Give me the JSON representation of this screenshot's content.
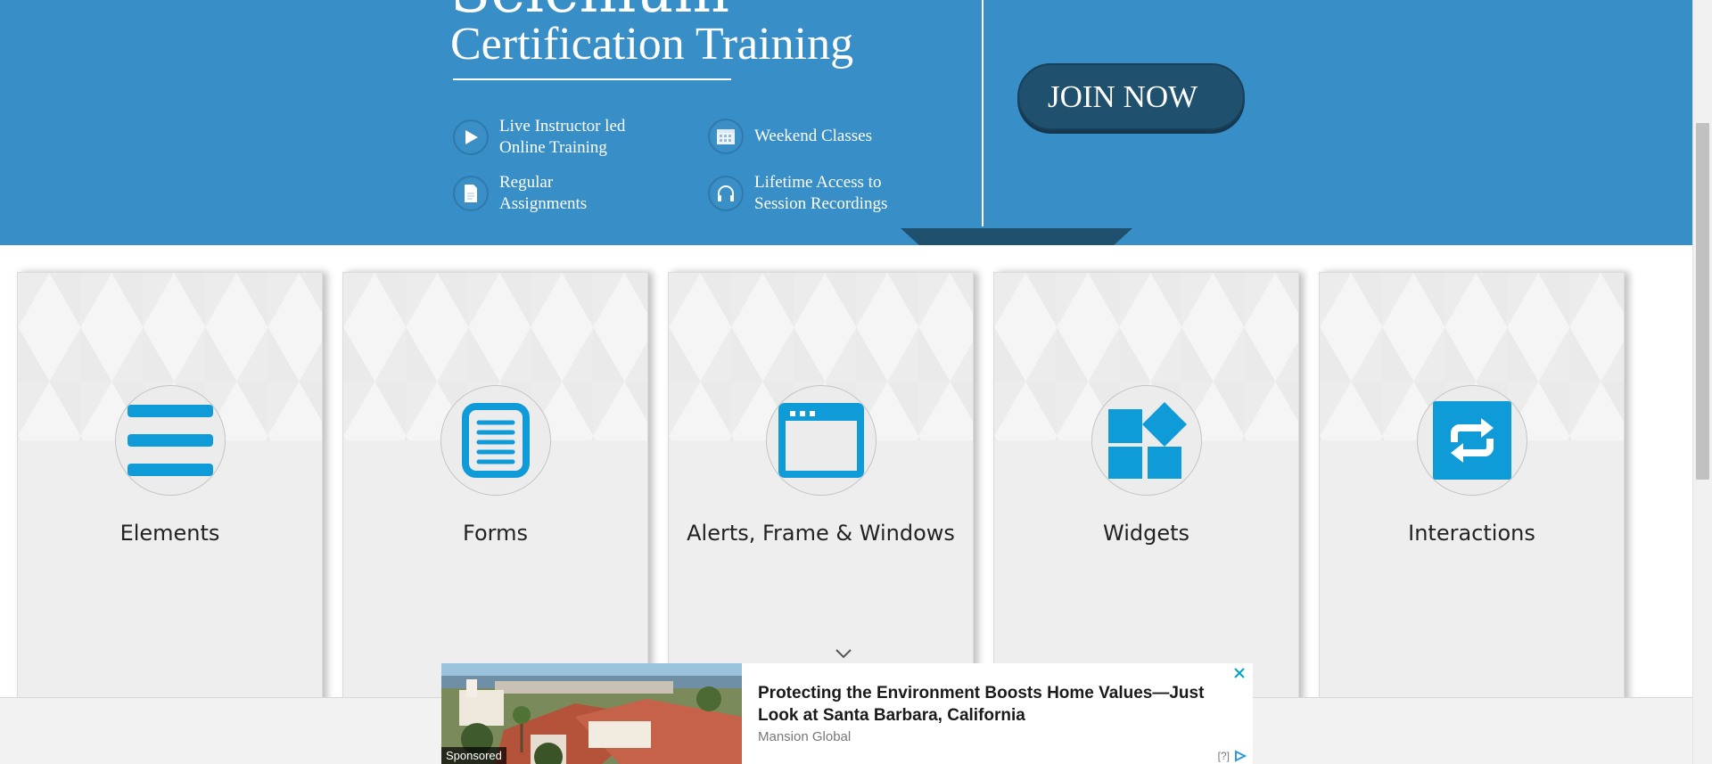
{
  "banner": {
    "title_top": "Selenium",
    "title": "Certification Training",
    "features": [
      {
        "icon": "play-icon",
        "text": "Live Instructor led\nOnline Training"
      },
      {
        "icon": "calendar-icon",
        "text": "Weekend Classes"
      },
      {
        "icon": "document-icon",
        "text": "Regular\nAssignments"
      },
      {
        "icon": "headphones-icon",
        "text": "Lifetime Access to\nSession Recordings"
      }
    ],
    "join_label": "JOIN NOW",
    "colors": {
      "background": "#388ec6",
      "button": "#1f506e"
    }
  },
  "cards": [
    {
      "title": "Elements",
      "icon": "hamburger-menu-icon"
    },
    {
      "title": "Forms",
      "icon": "form-document-icon"
    },
    {
      "title": "Alerts, Frame & Windows",
      "icon": "browser-window-icon"
    },
    {
      "title": "Widgets",
      "icon": "widgets-blocks-icon"
    },
    {
      "title": "Interactions",
      "icon": "swap-arrows-icon"
    }
  ],
  "card_icon_color": "#0f9ad8",
  "ad": {
    "sponsored_label": "Sponsored",
    "headline": "Protecting the Environment Boosts Home Values—Just Look at Santa Barbara, California",
    "source": "Mansion Global",
    "help_label": "[?]"
  }
}
